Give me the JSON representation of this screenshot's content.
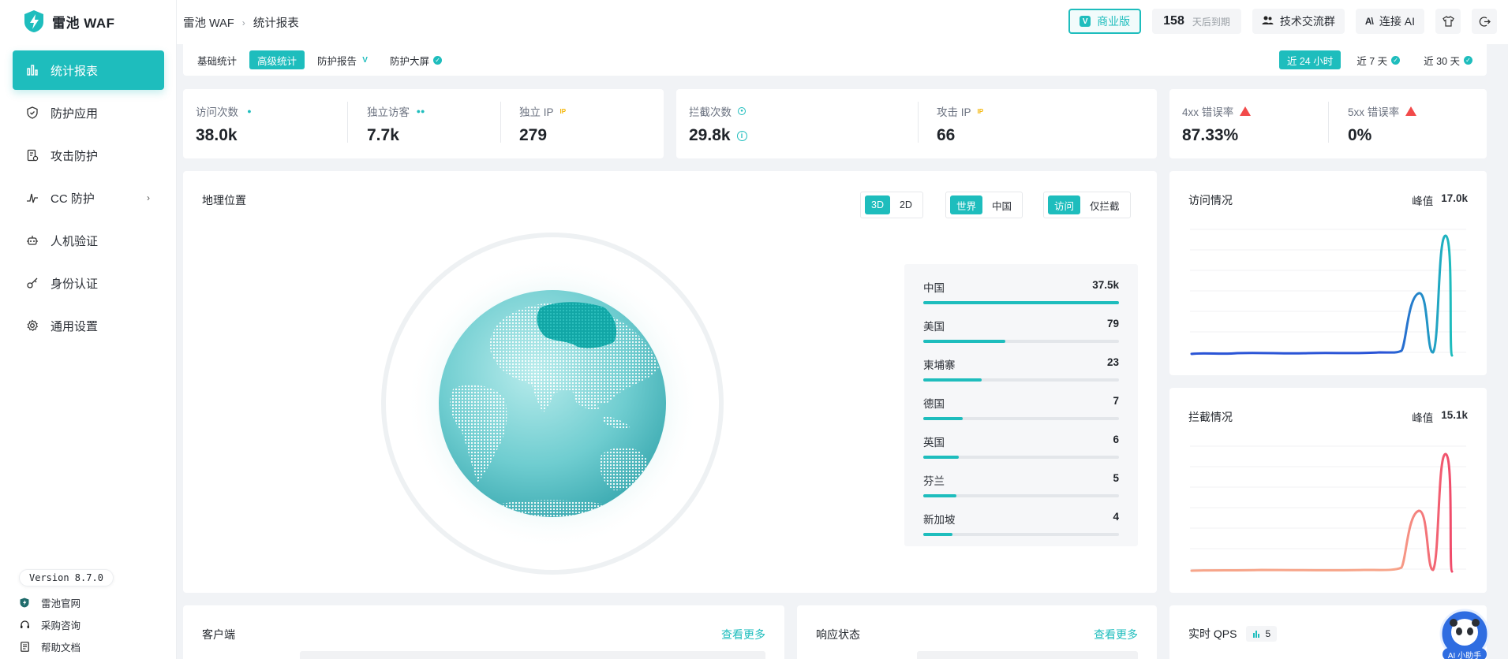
{
  "app": {
    "name": "雷池 WAF",
    "accent": "#1ebdbd"
  },
  "sidebar": {
    "items": [
      {
        "label": "统计报表",
        "icon": "bar-chart-icon",
        "active": true
      },
      {
        "label": "防护应用",
        "icon": "shield-icon"
      },
      {
        "label": "攻击防护",
        "icon": "document-shield-icon"
      },
      {
        "label": "CC 防护",
        "icon": "pulse-icon",
        "has_submenu": true
      },
      {
        "label": "人机验证",
        "icon": "robot-icon"
      },
      {
        "label": "身份认证",
        "icon": "key-icon"
      },
      {
        "label": "通用设置",
        "icon": "gear-icon"
      }
    ],
    "version": "Version 8.7.0",
    "footer_links": [
      {
        "label": "雷池官网",
        "icon": "shield-logo-icon"
      },
      {
        "label": "采购咨询",
        "icon": "headset-icon"
      },
      {
        "label": "帮助文档",
        "icon": "doc-icon"
      }
    ]
  },
  "header": {
    "breadcrumb": [
      "雷池 WAF",
      "统计报表"
    ],
    "edition": "商业版",
    "days_left": "158",
    "days_left_label": "天后到期",
    "community": "技术交流群",
    "connect_ai": "连接 AI"
  },
  "tabs": {
    "left": [
      {
        "label": "基础统计"
      },
      {
        "label": "高级统计",
        "active": true
      },
      {
        "label": "防护报告"
      },
      {
        "label": "防护大屏"
      }
    ],
    "right": [
      {
        "label": "近 24 小时",
        "active": true
      },
      {
        "label": "近 7 天"
      },
      {
        "label": "近 30 天"
      }
    ]
  },
  "stats": {
    "visits": {
      "label": "访问次数",
      "value": "38.0k"
    },
    "unique_visitors": {
      "label": "独立访客",
      "value": "7.7k"
    },
    "unique_ip": {
      "label": "独立 IP",
      "value": "279"
    },
    "blocked": {
      "label": "拦截次数",
      "value": "29.8k"
    },
    "attack_ip": {
      "label": "攻击 IP",
      "value": "66"
    },
    "err4xx": {
      "label": "4xx 错误率",
      "value": "87.33%"
    },
    "err5xx": {
      "label": "5xx 错误率",
      "value": "0%"
    }
  },
  "geo": {
    "title": "地理位置",
    "view": [
      "3D",
      "2D"
    ],
    "scope": [
      "世界",
      "中国"
    ],
    "mode": [
      "访问",
      "仅拦截"
    ],
    "countries": [
      {
        "name": "中国",
        "value": "37.5k",
        "ratio": 1.0
      },
      {
        "name": "美国",
        "value": "79",
        "ratio": 0.42
      },
      {
        "name": "柬埔寨",
        "value": "23",
        "ratio": 0.3
      },
      {
        "name": "德国",
        "value": "7",
        "ratio": 0.2
      },
      {
        "name": "英国",
        "value": "6",
        "ratio": 0.18
      },
      {
        "name": "芬兰",
        "value": "5",
        "ratio": 0.17
      },
      {
        "name": "新加坡",
        "value": "4",
        "ratio": 0.15
      }
    ]
  },
  "visits_chart": {
    "title": "访问情况",
    "peak_label": "峰值",
    "peak_value": "17.0k"
  },
  "blocked_chart": {
    "title": "拦截情况",
    "peak_label": "峰值",
    "peak_value": "15.1k"
  },
  "clients": {
    "title": "客户端",
    "more": "查看更多"
  },
  "responses": {
    "title": "响应状态",
    "more": "查看更多"
  },
  "qps": {
    "title": "实时 QPS",
    "value": "5"
  },
  "assistant": {
    "label": "AI 小助手"
  }
}
